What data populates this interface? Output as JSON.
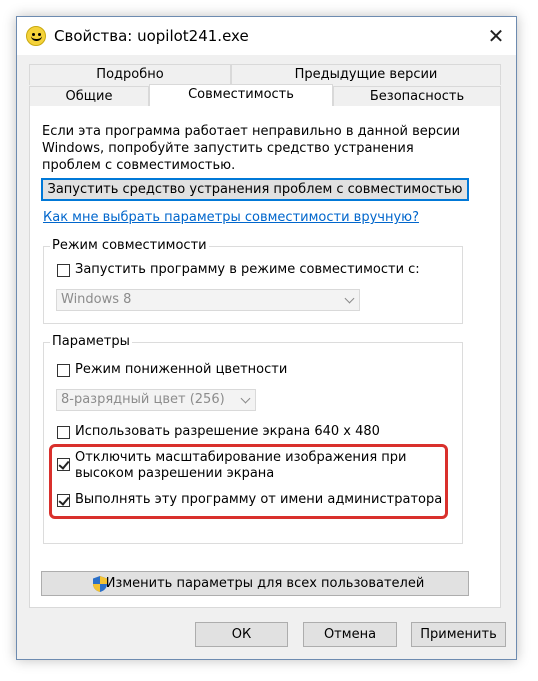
{
  "window": {
    "title": "Свойства: uopilot241.exe",
    "close_glyph": "✕"
  },
  "tabs": {
    "row1": [
      {
        "label": "Подробно"
      },
      {
        "label": "Предыдущие версии"
      }
    ],
    "row2": [
      {
        "label": "Общие"
      },
      {
        "label": "Совместимость",
        "active": true
      },
      {
        "label": "Безопасность"
      }
    ]
  },
  "compat": {
    "intro": "Если эта программа работает неправильно в данной версии Windows, попробуйте запустить средство устранения проблем с совместимостью.",
    "troubleshoot_button": "Запустить средство устранения проблем с совместимостью",
    "manual_link": "Как мне выбрать параметры совместимости вручную?",
    "mode_group": {
      "legend": "Режим совместимости",
      "checkbox_label": "Запустить программу в режиме совместимости с:",
      "checked": false,
      "os_select_value": "Windows 8"
    },
    "params_group": {
      "legend": "Параметры",
      "reduced_color": {
        "label": "Режим пониженной цветности",
        "checked": false
      },
      "color_select_value": "8-разрядный цвет (256)",
      "res_640": {
        "label": "Использовать разрешение экрана 640 x 480",
        "checked": false
      },
      "disable_scaling": {
        "label_line1": "Отключить масштабирование изображения при",
        "label_line2": "высоком разрешении экрана",
        "checked": true
      },
      "run_as_admin": {
        "label": "Выполнять эту программу от имени администратора",
        "checked": true
      }
    },
    "all_users_button": "Изменить параметры для всех пользователей"
  },
  "footer": {
    "ok": "ОК",
    "cancel": "Отмена",
    "apply": "Применить"
  },
  "colors": {
    "highlight": "#d9302c",
    "link": "#0066cc",
    "focus": "#0078d7"
  }
}
